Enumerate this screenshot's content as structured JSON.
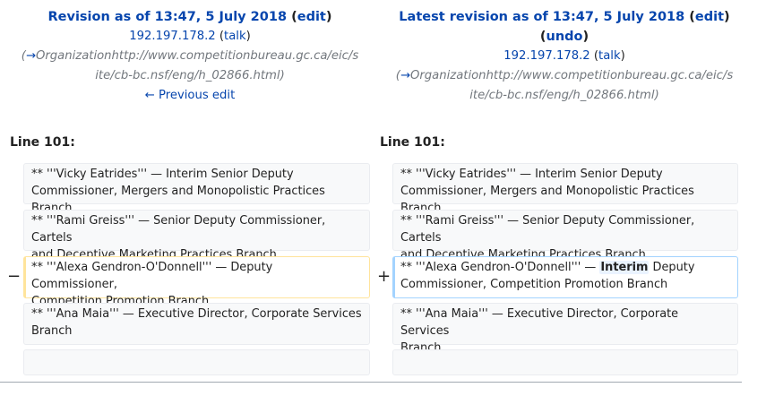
{
  "left": {
    "title_prefix": "Revision as of 13:47, 5 July 2018",
    "edit_label": "edit",
    "user": "192.197.178.2",
    "talk": "talk",
    "comment_arrow": "→",
    "comment_line1": "Organizationhttp://www.competitionbureau.gc.ca/eic/s",
    "comment_line2": "ite/cb-bc.nsf/eng/h_02866.html",
    "prev_edit": "← Previous edit",
    "line_label": "Line 101:"
  },
  "right": {
    "title_prefix": "Latest revision as of 13:47, 5 July 2018",
    "edit_label": "edit",
    "undo_label": "undo",
    "user": "192.197.178.2",
    "talk": "talk",
    "comment_arrow": "→",
    "comment_line1": "Organizationhttp://www.competitionbureau.gc.ca/eic/s",
    "comment_line2": "ite/cb-bc.nsf/eng/h_02866.html",
    "line_label": "Line 101:"
  },
  "diff": {
    "ctx1_a": "** '''Vicky Eatrides'''  — Interim Senior Deputy",
    "ctx1_b": "Commissioner, Mergers and Monopolistic Practices Branch",
    "ctx2_a": "** '''Rami Greiss''' — Senior Deputy Commissioner, Cartels",
    "ctx2_b": "and Deceptive Marketing Practices Branch",
    "del_a": "** '''Alexa Gendron-O'Donnell''' — Deputy Commissioner,",
    "del_b": "Competition Promotion Branch",
    "add_a_pre": "** '''Alexa Gendron-O'Donnell''' — ",
    "add_a_hl": "Interim",
    "add_a_post": " Deputy",
    "add_b": "Commissioner, Competition Promotion Branch",
    "ctx3_a": "** '''Ana Maia''' — Executive Director, Corporate Services",
    "ctx3_b": "Branch",
    "minus": "−",
    "plus": "+"
  }
}
